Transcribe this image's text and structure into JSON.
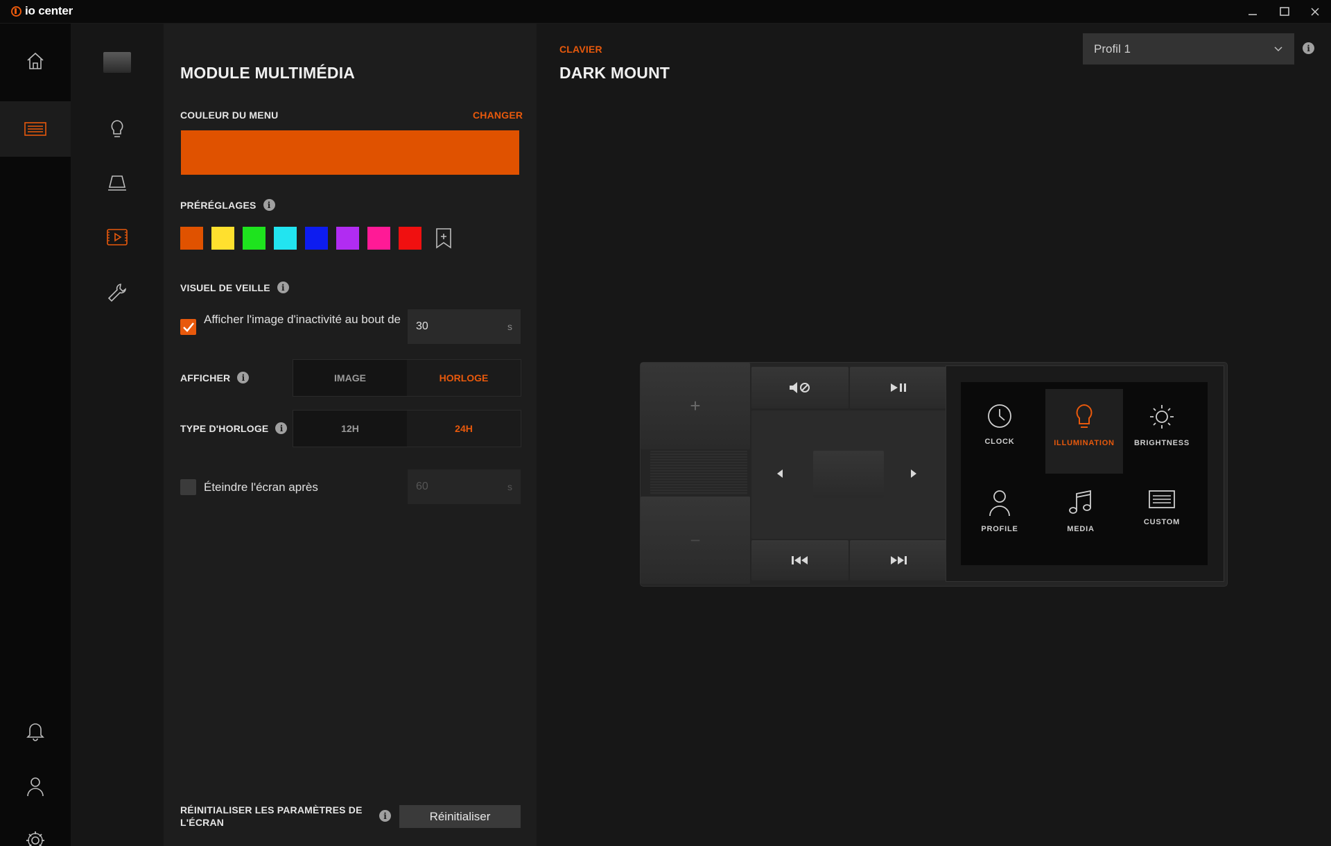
{
  "app": {
    "name": "io center"
  },
  "window": {
    "minimize": "—",
    "maximize": "☐",
    "close": "✕"
  },
  "header": {
    "section": "CLAVIER",
    "device": "DARK MOUNT",
    "profile": "Profil 1"
  },
  "settings": {
    "title": "MODULE MULTIMÉDIA",
    "menu_color_label": "COULEUR DU MENU",
    "change_label": "CHANGER",
    "menu_color": "#e05200",
    "presets_label": "PRÉRÉGLAGES",
    "presets": [
      "#e05200",
      "#ffe02e",
      "#1ee31e",
      "#22e4f0",
      "#0d1cf0",
      "#b12cf2",
      "#ff1a96",
      "#f01010"
    ],
    "standby_label": "VISUEL DE VEILLE",
    "idle_text": "Afficher l'image d'inactivité au bout de",
    "idle_value": "30",
    "idle_unit": "s",
    "display_label": "AFFICHER",
    "display_options": [
      "IMAGE",
      "HORLOGE"
    ],
    "display_selected": "HORLOGE",
    "clock_type_label": "TYPE D'HORLOGE",
    "clock_options": [
      "12H",
      "24H"
    ],
    "clock_selected": "24H",
    "screen_off_text": "Éteindre l'écran après",
    "screen_off_value": "60",
    "screen_off_unit": "s",
    "reset_label": "RÉINITIALISER LES PARAMÈTRES DE L'ÉCRAN",
    "reset_button": "Réinitialiser"
  },
  "keyboard_screen": {
    "tiles": [
      "CLOCK",
      "ILLUMINATION",
      "BRIGHTNESS",
      "PROFILE",
      "MEDIA",
      "CUSTOM"
    ],
    "selected": "ILLUMINATION",
    "plus": "+",
    "minus": "−"
  },
  "colors": {
    "accent": "#e8590c"
  }
}
